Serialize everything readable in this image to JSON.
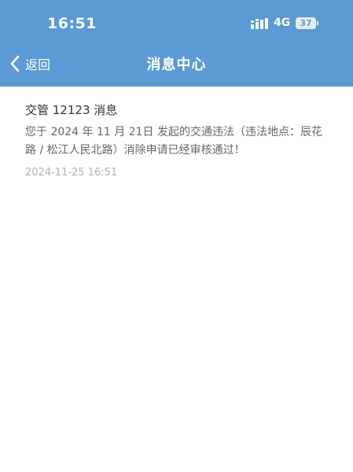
{
  "status_bar": {
    "time": "16:51",
    "network": "4G",
    "battery": "37"
  },
  "nav": {
    "back_label": "返回",
    "title": "消息中心"
  },
  "messages": [
    {
      "title": "交管 12123 消息",
      "body": "您于 2024 年 11 月 21日 发起的交通违法（违法地点：辰花路 / 松江人民北路）消除申请已经审核通过！",
      "time": "2024-11-25 16:51"
    }
  ],
  "colors": {
    "header_bg": "#5a9bd5",
    "header_text": "#ffffff",
    "title_text": "#333333",
    "body_text": "#666666",
    "time_text": "#b3b3b3"
  }
}
